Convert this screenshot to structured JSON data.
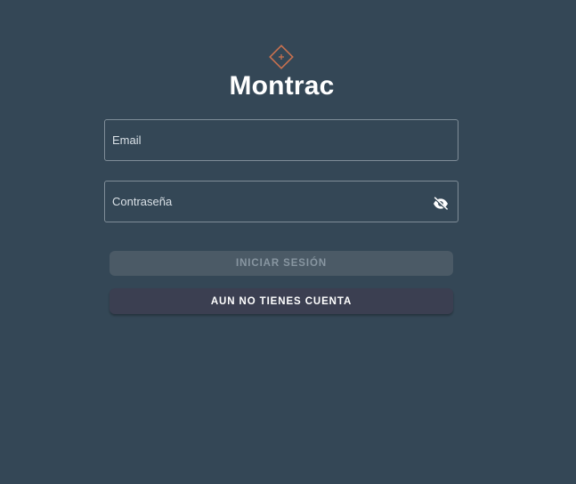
{
  "app": {
    "title": "Montrac",
    "logo_icon": "diamond-plus-icon",
    "logo_color": "#c8714f"
  },
  "form": {
    "email": {
      "placeholder": "Email",
      "value": ""
    },
    "password": {
      "placeholder": "Contraseña",
      "value": "",
      "toggle_icon": "eye-off-icon"
    }
  },
  "buttons": {
    "login_label": "INICIAR SESIÓN",
    "login_disabled": true,
    "register_label": "AUN NO TIENES CUENTA"
  },
  "colors": {
    "background": "#344756",
    "login_button": "#4b5a66",
    "register_button": "#3b3f51"
  }
}
